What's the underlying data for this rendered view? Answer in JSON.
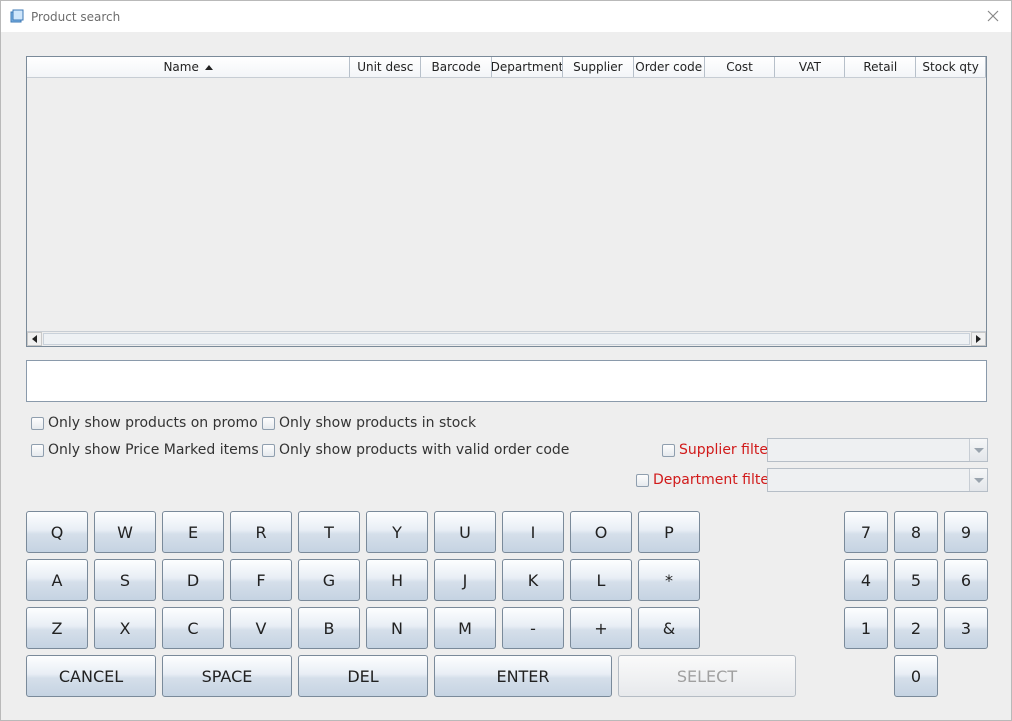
{
  "window": {
    "title": "Product search"
  },
  "table": {
    "columns": [
      {
        "label": "Name",
        "sorted": "ascending"
      },
      {
        "label": "Unit desc"
      },
      {
        "label": "Barcode"
      },
      {
        "label": "Department"
      },
      {
        "label": "Supplier"
      },
      {
        "label": "Order code"
      },
      {
        "label": "Cost"
      },
      {
        "label": "VAT"
      },
      {
        "label": "Retail"
      },
      {
        "label": "Stock qty"
      }
    ],
    "rows": []
  },
  "search": {
    "value": ""
  },
  "filters": {
    "promo": {
      "label": "Only show products on promo",
      "checked": false
    },
    "in_stock": {
      "label": "Only show products in stock",
      "checked": false
    },
    "price_marked": {
      "label": "Only show Price Marked items",
      "checked": false
    },
    "valid_order_code": {
      "label": "Only show products with valid order code",
      "checked": false
    },
    "supplier": {
      "label": "Supplier filter",
      "checked": false,
      "value": ""
    },
    "department": {
      "label": "Department filter",
      "checked": false,
      "value": ""
    }
  },
  "keyboard": {
    "row1": [
      "Q",
      "W",
      "E",
      "R",
      "T",
      "Y",
      "U",
      "I",
      "O",
      "P"
    ],
    "row2": [
      "A",
      "S",
      "D",
      "F",
      "G",
      "H",
      "J",
      "K",
      "L",
      "*"
    ],
    "row3": [
      "Z",
      "X",
      "C",
      "V",
      "B",
      "N",
      "M",
      "-",
      "+",
      "&"
    ],
    "actions": {
      "cancel": "CANCEL",
      "space": "SPACE",
      "del": "DEL",
      "enter": "ENTER",
      "select": "SELECT"
    }
  },
  "numpad": {
    "row1": [
      "7",
      "8",
      "9"
    ],
    "row2": [
      "4",
      "5",
      "6"
    ],
    "row3": [
      "1",
      "2",
      "3"
    ],
    "zero": "0"
  },
  "colors": {
    "filter_label_red": "#d11a1a",
    "key_border": "#7a8a9a"
  }
}
